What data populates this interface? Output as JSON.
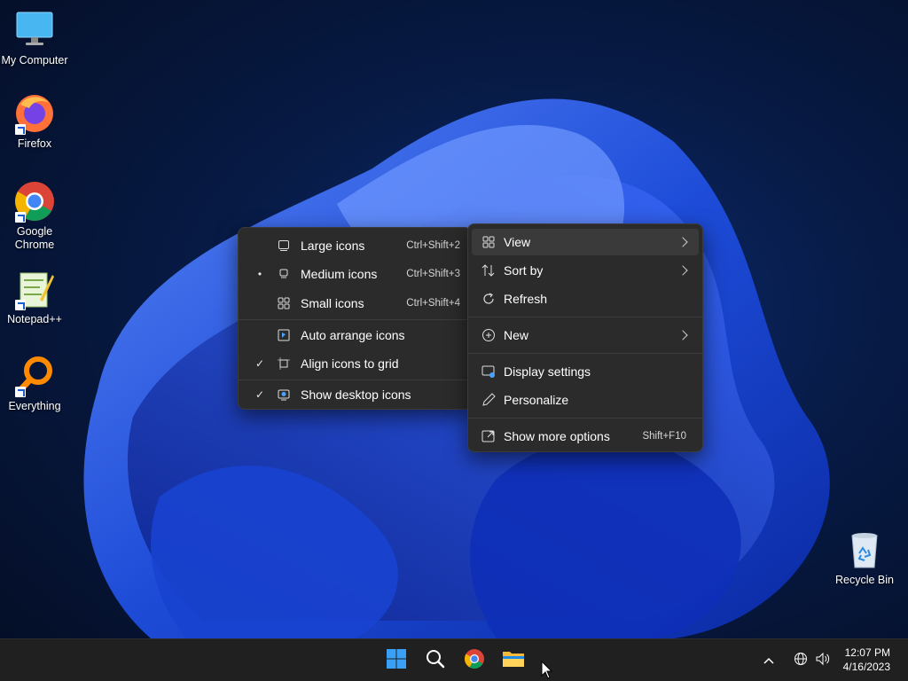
{
  "desktop": {
    "icons": [
      {
        "label": "My Computer",
        "icon": "monitor-icon"
      },
      {
        "label": "Firefox",
        "icon": "firefox-icon"
      },
      {
        "label": "Google Chrome",
        "icon": "chrome-icon"
      },
      {
        "label": "Notepad++",
        "icon": "notepad-plus-plus-icon"
      },
      {
        "label": "Everything",
        "icon": "everything-search-icon"
      },
      {
        "label": "Recycle Bin",
        "icon": "recycle-bin-icon"
      }
    ]
  },
  "context_menu": {
    "items": [
      {
        "label": "View",
        "icon": "grid-icon",
        "submenu": true,
        "highlighted": true
      },
      {
        "label": "Sort by",
        "icon": "sort-icon",
        "submenu": true
      },
      {
        "label": "Refresh",
        "icon": "refresh-icon"
      },
      {
        "label": "New",
        "icon": "plus-circle-icon",
        "submenu": true
      },
      {
        "label": "Display settings",
        "icon": "display-settings-icon"
      },
      {
        "label": "Personalize",
        "icon": "pen-icon"
      },
      {
        "label": "Show more options",
        "icon": "open-external-icon",
        "shortcut": "Shift+F10"
      }
    ]
  },
  "view_submenu": {
    "items": [
      {
        "label": "Large icons",
        "shortcut": "Ctrl+Shift+2",
        "icon": "large-icons-icon",
        "selected": false
      },
      {
        "label": "Medium icons",
        "shortcut": "Ctrl+Shift+3",
        "icon": "medium-icons-icon",
        "selected": true,
        "mark": "•"
      },
      {
        "label": "Small icons",
        "shortcut": "Ctrl+Shift+4",
        "icon": "small-icons-icon",
        "selected": false
      },
      {
        "label": "Auto arrange icons",
        "icon": "auto-arrange-icon",
        "checked": false
      },
      {
        "label": "Align icons to grid",
        "icon": "align-grid-icon",
        "checked": true,
        "mark": "✓"
      },
      {
        "label": "Show desktop icons",
        "icon": "show-desktop-icon",
        "checked": true,
        "mark": "✓"
      }
    ]
  },
  "taskbar": {
    "pinned": [
      {
        "name": "start-button",
        "icon": "windows-logo-icon"
      },
      {
        "name": "search-button",
        "icon": "search-icon"
      },
      {
        "name": "chrome-taskbar-button",
        "icon": "chrome-icon"
      },
      {
        "name": "file-explorer-button",
        "icon": "folder-icon"
      }
    ],
    "tray": {
      "chevron": "^",
      "network": "globe-icon",
      "volume": "speaker-icon"
    },
    "time": "12:07 PM",
    "date": "4/16/2023"
  },
  "colors": {
    "accent": "#1a5fd1",
    "menu_bg": "#2b2b2b",
    "taskbar_bg": "#202020"
  }
}
